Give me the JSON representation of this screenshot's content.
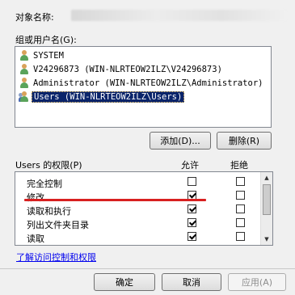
{
  "header": {
    "object_name_label": "对象名称:",
    "group_label": "组或用户名(G):"
  },
  "users": [
    {
      "name": "SYSTEM",
      "selected": false
    },
    {
      "name": "V24296873 (WIN-NLRTEOW2ILZ\\V24296873)",
      "selected": false
    },
    {
      "name": "Administrator (WIN-NLRTEOW2ILZ\\Administrator)",
      "selected": false
    },
    {
      "name": "Users (WIN-NLRTEOW2ILZ\\Users)",
      "selected": true
    }
  ],
  "buttons": {
    "add": "添加(D)...",
    "remove": "删除(R)",
    "ok": "确定",
    "cancel": "取消",
    "apply": "应用(A)"
  },
  "permissions": {
    "title": "Users 的权限(P)",
    "allow_header": "允许",
    "deny_header": "拒绝",
    "rows": [
      {
        "name": "完全控制",
        "allow": false,
        "deny": false
      },
      {
        "name": "修改",
        "allow": true,
        "deny": false
      },
      {
        "name": "读取和执行",
        "allow": true,
        "deny": false
      },
      {
        "name": "列出文件夹目录",
        "allow": true,
        "deny": false
      },
      {
        "name": "读取",
        "allow": true,
        "deny": false
      }
    ]
  },
  "link": "了解访问控制和权限",
  "colors": {
    "selection": "#0a246a",
    "annotation_line": "#d82020",
    "link": "#0000ee"
  },
  "icons": {
    "user": "user-icon",
    "group": "group-icon",
    "scroll_up": "scroll-up-arrow",
    "scroll_down": "scroll-down-arrow"
  }
}
